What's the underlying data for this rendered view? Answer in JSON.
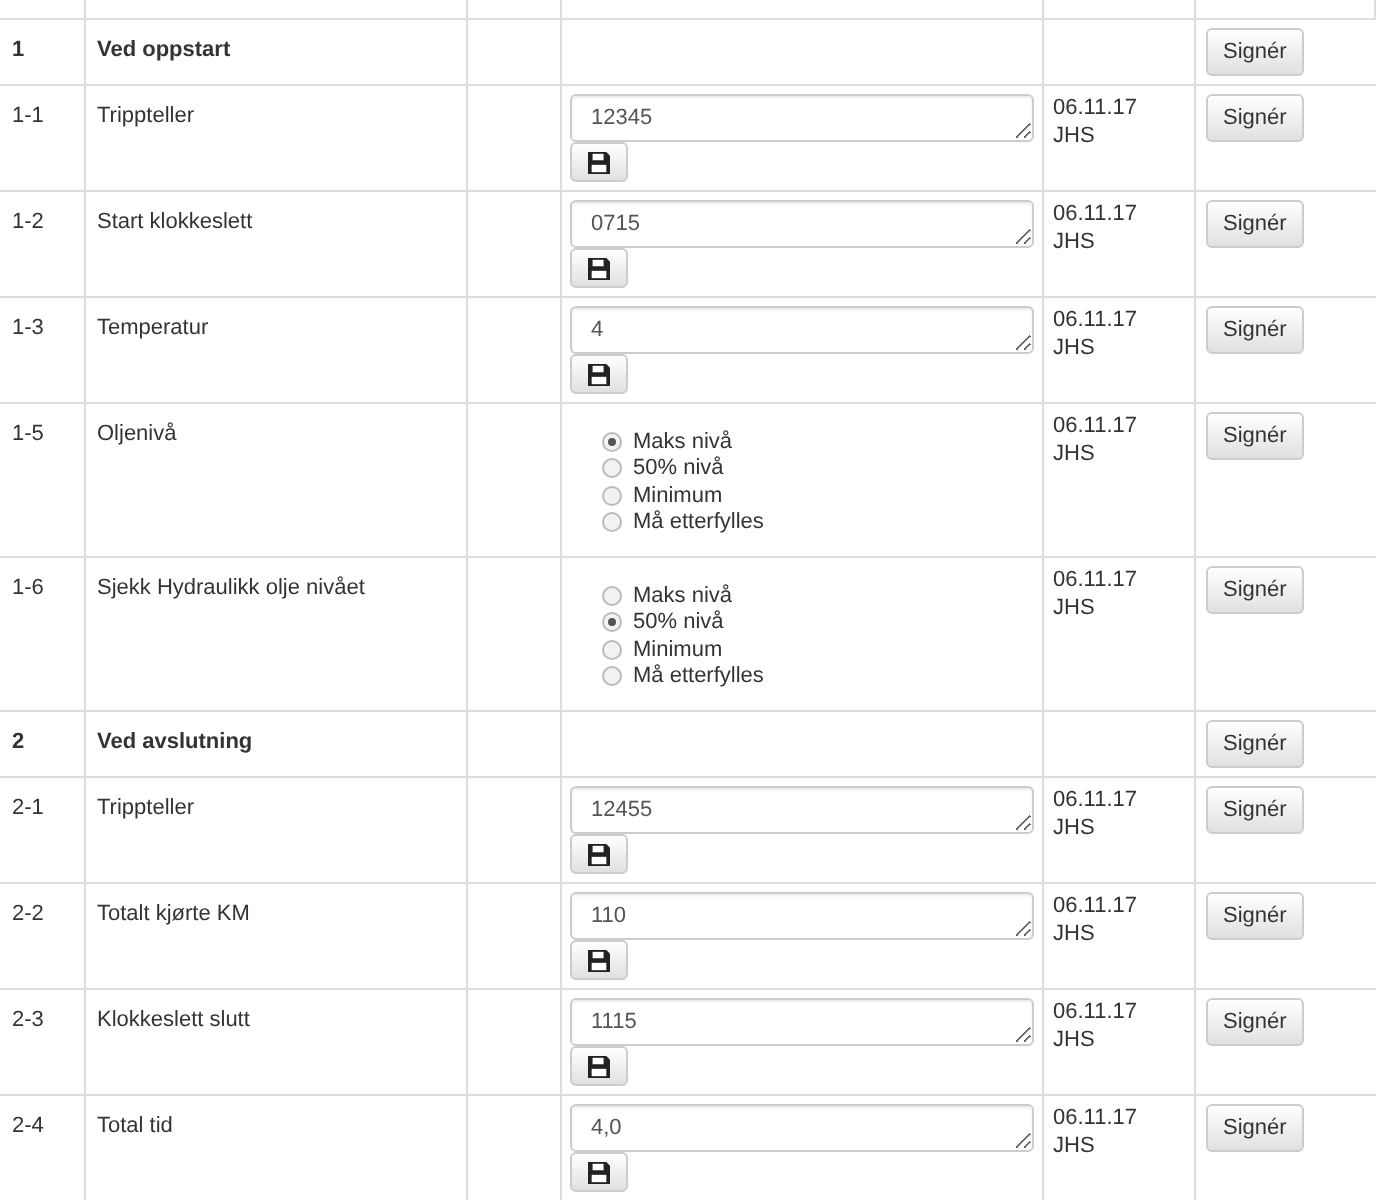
{
  "rows": [
    {
      "kind": "section",
      "number": "1",
      "label": "Ved oppstart",
      "button": "Signér"
    },
    {
      "kind": "input",
      "number": "1-1",
      "label": "Trippteller",
      "value": "12345",
      "date": "06.11.17",
      "initials": "JHS",
      "button": "Signér"
    },
    {
      "kind": "input",
      "number": "1-2",
      "label": "Start klokkeslett",
      "value": "0715",
      "date": "06.11.17",
      "initials": "JHS",
      "button": "Signér"
    },
    {
      "kind": "input",
      "number": "1-3",
      "label": "Temperatur",
      "value": "4",
      "date": "06.11.17",
      "initials": "JHS",
      "button": "Signér"
    },
    {
      "kind": "radio",
      "number": "1-5",
      "label": "Oljenivå",
      "options": [
        {
          "label": "Maks nivå",
          "selected": true
        },
        {
          "label": "50% nivå",
          "selected": false
        },
        {
          "label": "Minimum",
          "selected": false
        },
        {
          "label": "Må etterfylles",
          "selected": false
        }
      ],
      "date": "06.11.17",
      "initials": "JHS",
      "button": "Signér"
    },
    {
      "kind": "radio",
      "number": "1-6",
      "label": "Sjekk Hydraulikk olje nivået",
      "options": [
        {
          "label": "Maks nivå",
          "selected": false
        },
        {
          "label": "50% nivå",
          "selected": true
        },
        {
          "label": "Minimum",
          "selected": false
        },
        {
          "label": "Må etterfylles",
          "selected": false
        }
      ],
      "date": "06.11.17",
      "initials": "JHS",
      "button": "Signér"
    },
    {
      "kind": "section",
      "number": "2",
      "label": "Ved avslutning",
      "button": "Signér"
    },
    {
      "kind": "input",
      "number": "2-1",
      "label": "Trippteller",
      "value": "12455",
      "date": "06.11.17",
      "initials": "JHS",
      "button": "Signér"
    },
    {
      "kind": "input",
      "number": "2-2",
      "label": "Totalt kjørte KM",
      "value": "110",
      "date": "06.11.17",
      "initials": "JHS",
      "button": "Signér"
    },
    {
      "kind": "input",
      "number": "2-3",
      "label": "Klokkeslett slutt",
      "value": "1115",
      "date": "06.11.17",
      "initials": "JHS",
      "button": "Signér"
    },
    {
      "kind": "input",
      "number": "2-4",
      "label": "Total tid",
      "value": "4,0",
      "date": "06.11.17",
      "initials": "JHS",
      "button": "Signér"
    }
  ]
}
